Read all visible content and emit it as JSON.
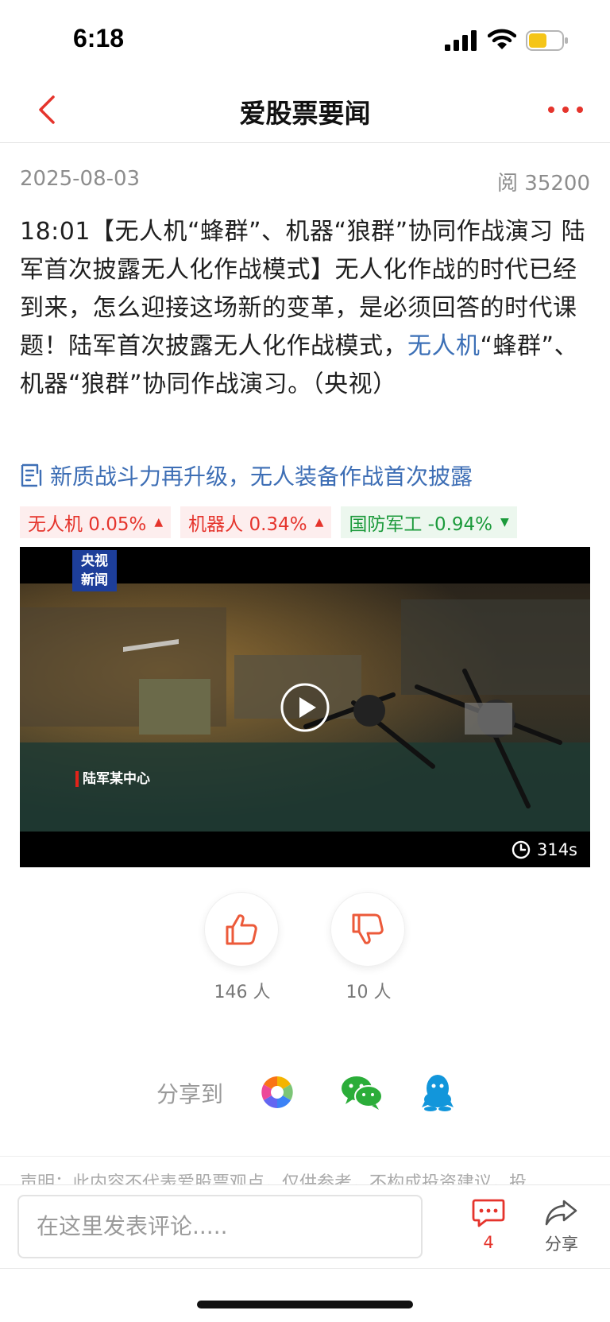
{
  "status_bar": {
    "time": "6:18",
    "battery_color": "#f5c518"
  },
  "navbar": {
    "title": "爱股票要闻",
    "accent": "#e5342c"
  },
  "meta": {
    "date": "2025-08-03",
    "reads": "阅 35200"
  },
  "article": {
    "part1": "18:01【无人机“蜂群”、机器“狼群”协同作战演习 陆军首次披露无人化作战模式】无人化作战的时代已经到来，怎么迎接这场新的变革，是必须回答的时代课题！陆军首次披露无人化作战模式，",
    "keyword": "无人机",
    "part2": "“蜂群”、机器“狼群”协同作战演习。（央视）"
  },
  "related": {
    "icon": "doc-icon",
    "text": "新质战斗力再升级，无人装备作战首次披露"
  },
  "tags": [
    {
      "label": "无人机 0.05%",
      "trend": "up"
    },
    {
      "label": "机器人 0.34%",
      "trend": "up"
    },
    {
      "label": "国防军工 -0.94%",
      "trend": "down"
    }
  ],
  "video": {
    "logo_line1": "央视",
    "logo_line2": "新闻",
    "caption": "陆军某中心",
    "duration": "314s"
  },
  "reactions": {
    "likes": "146 人",
    "dislikes": "10 人"
  },
  "share": {
    "label": "分享到",
    "targets": [
      "moments-icon",
      "wechat-icon",
      "qq-icon"
    ]
  },
  "disclaimer": "声明：此内容不代表爱股票观点，仅供参考，不构成投资建议，投",
  "bottom_bar": {
    "comment_placeholder": "在这里发表评论.....",
    "comment_count": "4",
    "share_label": "分享"
  }
}
